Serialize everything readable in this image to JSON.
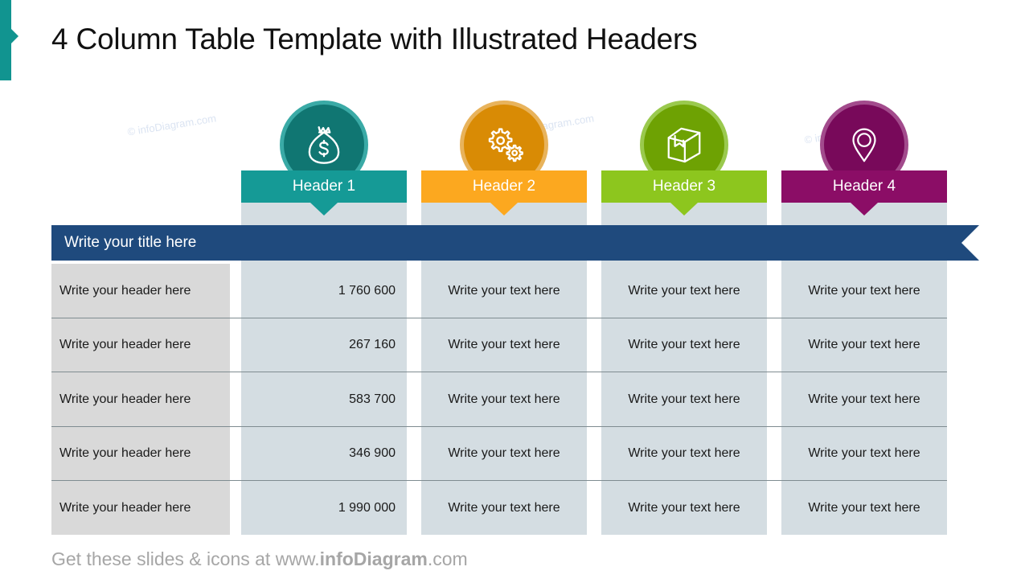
{
  "slide": {
    "title": "4 Column Table Template with Illustrated Headers",
    "accent_color": "#119490"
  },
  "watermark": {
    "text": "© infoDiagram.com"
  },
  "columns": [
    {
      "header_label": "Header 1",
      "icon": "money-bag-icon",
      "color": "#159a96",
      "circle_color": "#107672",
      "ring_color": "#3aaaa6"
    },
    {
      "header_label": "Header 2",
      "icon": "gears-icon",
      "color": "#fca81f",
      "circle_color": "#d98b05",
      "ring_color": "#e8b35c"
    },
    {
      "header_label": "Header 3",
      "icon": "box-package-icon",
      "color": "#8dc61e",
      "circle_color": "#6ea203",
      "ring_color": "#9ac94e"
    },
    {
      "header_label": "Header 4",
      "icon": "map-pin-icon",
      "color": "#8b0d66",
      "circle_color": "#78095a",
      "ring_color": "#a24b8c"
    }
  ],
  "table": {
    "title_bar": {
      "label": "Write your title here",
      "color": "#1f4a7d"
    },
    "rows": [
      {
        "label": "Write your header  here",
        "value": "1 760 600",
        "col2": "Write your text here",
        "col3": "Write your text here",
        "col4": "Write your text here"
      },
      {
        "label": "Write your header  here",
        "value": "267 160",
        "col2": "Write your text here",
        "col3": "Write your text here",
        "col4": "Write your text here"
      },
      {
        "label": "Write your header  here",
        "value": "583 700",
        "col2": "Write your text here",
        "col3": "Write your text here",
        "col4": "Write your text here"
      },
      {
        "label": "Write your header  here",
        "value": "346 900",
        "col2": "Write your text here",
        "col3": "Write your text here",
        "col4": "Write your text here"
      },
      {
        "label": "Write your header  here",
        "value": "1 990 000",
        "col2": "Write your text here",
        "col3": "Write your text here",
        "col4": "Write your text here"
      }
    ]
  },
  "footer": {
    "prefix": "Get these slides & icons at www.",
    "brand": "infoDiagram",
    "suffix": ".com"
  }
}
